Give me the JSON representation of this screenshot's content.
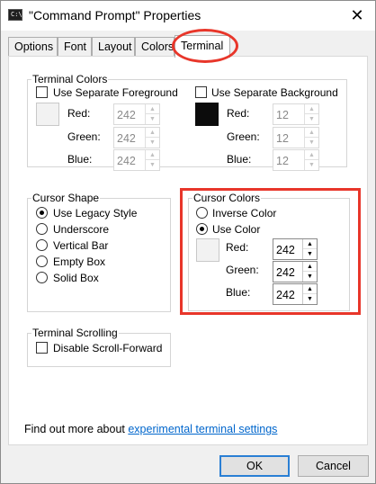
{
  "window": {
    "title": "\"Command Prompt\" Properties",
    "icon_text": "C:\\",
    "close_glyph": "✕"
  },
  "tabs": [
    {
      "label": "Options",
      "active": false
    },
    {
      "label": "Font",
      "active": false
    },
    {
      "label": "Layout",
      "active": false
    },
    {
      "label": "Colors",
      "active": false
    },
    {
      "label": "Terminal",
      "active": true
    }
  ],
  "terminal_colors": {
    "legend": "Terminal Colors",
    "foreground": {
      "checkbox_label": "Use Separate Foreground",
      "checked": false,
      "swatch_color": "#f2f2f2",
      "red_label": "Red:",
      "red": "242",
      "green_label": "Green:",
      "green": "242",
      "blue_label": "Blue:",
      "blue": "242"
    },
    "background": {
      "checkbox_label": "Use Separate Background",
      "checked": false,
      "swatch_color": "#0c0c0c",
      "red_label": "Red:",
      "red": "12",
      "green_label": "Green:",
      "green": "12",
      "blue_label": "Blue:",
      "blue": "12"
    }
  },
  "cursor_shape": {
    "legend": "Cursor Shape",
    "options": [
      "Use Legacy Style",
      "Underscore",
      "Vertical Bar",
      "Empty Box",
      "Solid Box"
    ],
    "selected": "Use Legacy Style"
  },
  "cursor_colors": {
    "legend": "Cursor Colors",
    "options": [
      "Inverse Color",
      "Use Color"
    ],
    "selected": "Use Color",
    "swatch_color": "#f2f2f2",
    "red_label": "Red:",
    "red": "242",
    "green_label": "Green:",
    "green": "242",
    "blue_label": "Blue:",
    "blue": "242"
  },
  "terminal_scrolling": {
    "legend": "Terminal Scrolling",
    "checkbox_label": "Disable Scroll-Forward",
    "checked": false
  },
  "footer": {
    "prefix": "Find out more about ",
    "link_text": "experimental terminal settings"
  },
  "buttons": {
    "ok": "OK",
    "cancel": "Cancel"
  },
  "annotation_color": "#e8362a",
  "spin_up_glyph": "▲",
  "spin_down_glyph": "▼"
}
